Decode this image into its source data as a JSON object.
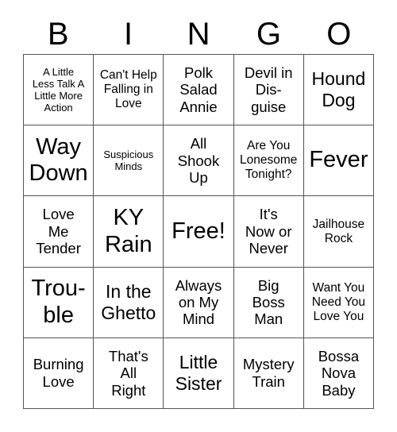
{
  "header": {
    "letters": [
      "B",
      "I",
      "N",
      "G",
      "O"
    ]
  },
  "grid": {
    "rows": [
      [
        {
          "text": "A Little\nLess Talk A\nLittle More\nAction",
          "size": "fs-xs"
        },
        {
          "text": "Can't Help\nFalling in\nLove",
          "size": "fs-sm"
        },
        {
          "text": "Polk\nSalad\nAnnie",
          "size": "fs-md"
        },
        {
          "text": "Devil in\nDis-\nguise",
          "size": "fs-md"
        },
        {
          "text": "Hound\nDog",
          "size": "fs-lg"
        }
      ],
      [
        {
          "text": "Way\nDown",
          "size": "fs-xl"
        },
        {
          "text": "Suspicious\nMinds",
          "size": "fs-xs"
        },
        {
          "text": "All\nShook\nUp",
          "size": "fs-md"
        },
        {
          "text": "Are You\nLonesome\nTonight?",
          "size": "fs-sm"
        },
        {
          "text": "Fever",
          "size": "fs-xl"
        }
      ],
      [
        {
          "text": "Love\nMe\nTender",
          "size": "fs-md"
        },
        {
          "text": "KY\nRain",
          "size": "fs-xl"
        },
        {
          "text": "Free!",
          "size": "fs-xl"
        },
        {
          "text": "It's\nNow or\nNever",
          "size": "fs-md"
        },
        {
          "text": "Jailhouse\nRock",
          "size": "fs-sm"
        }
      ],
      [
        {
          "text": "Trou-\nble",
          "size": "fs-xl"
        },
        {
          "text": "In the\nGhetto",
          "size": "fs-lg"
        },
        {
          "text": "Always\non My\nMind",
          "size": "fs-md"
        },
        {
          "text": "Big\nBoss\nMan",
          "size": "fs-md"
        },
        {
          "text": "Want You\nNeed You\nLove You",
          "size": "fs-sm"
        }
      ],
      [
        {
          "text": "Burning\nLove",
          "size": "fs-md"
        },
        {
          "text": "That's\nAll\nRight",
          "size": "fs-md"
        },
        {
          "text": "Little\nSister",
          "size": "fs-lg"
        },
        {
          "text": "Mystery\nTrain",
          "size": "fs-md"
        },
        {
          "text": "Bossa\nNova\nBaby",
          "size": "fs-md"
        }
      ]
    ]
  },
  "colors": {
    "background": "#ffffff",
    "text": "#000000",
    "grid_line": "#555555"
  }
}
